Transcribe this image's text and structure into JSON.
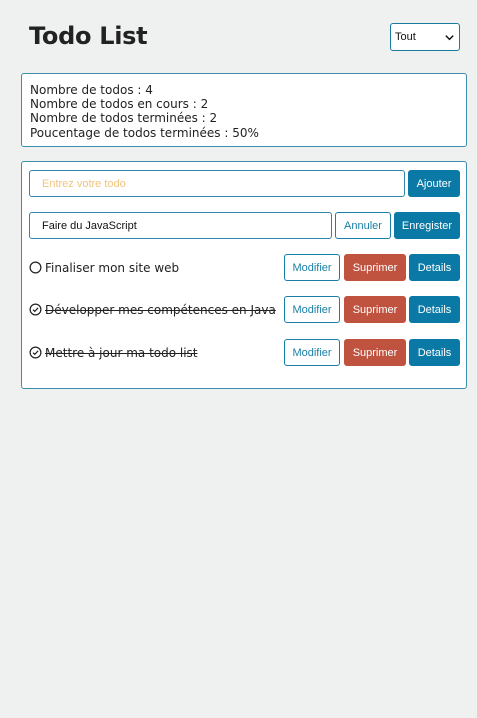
{
  "header": {
    "title": "Todo List",
    "filter_selected": "Tout"
  },
  "stats": {
    "line1": "Nombre de todos : 4",
    "line2": "Nombre de todos en cours : 2",
    "line3": "Nombre de todos terminées : 2",
    "line4": "Poucentage de todos terminées : 50%"
  },
  "form": {
    "new_placeholder": "Entrez votre todo",
    "add_label": "Ajouter",
    "edit_value": "Faire du JavaScript",
    "cancel_label": "Annuler",
    "save_label": "Enregister"
  },
  "todos": [
    {
      "label": "Finaliser mon site web",
      "done": false,
      "icon": "circle-icon"
    },
    {
      "label": "Développer mes compétences en Java",
      "done": true,
      "icon": "check-circle-icon"
    },
    {
      "label": "Mettre à jour ma todo list",
      "done": true,
      "icon": "check-circle-icon"
    }
  ],
  "actions": {
    "modify_label": "Modifier",
    "delete_label": "Suprimer",
    "details_label": "Details"
  },
  "colors": {
    "accent": "#0b79a6",
    "danger": "#bf5340",
    "border": "#3e8cae",
    "placeholder": "#f0c47e",
    "background": "#eff1f0"
  }
}
